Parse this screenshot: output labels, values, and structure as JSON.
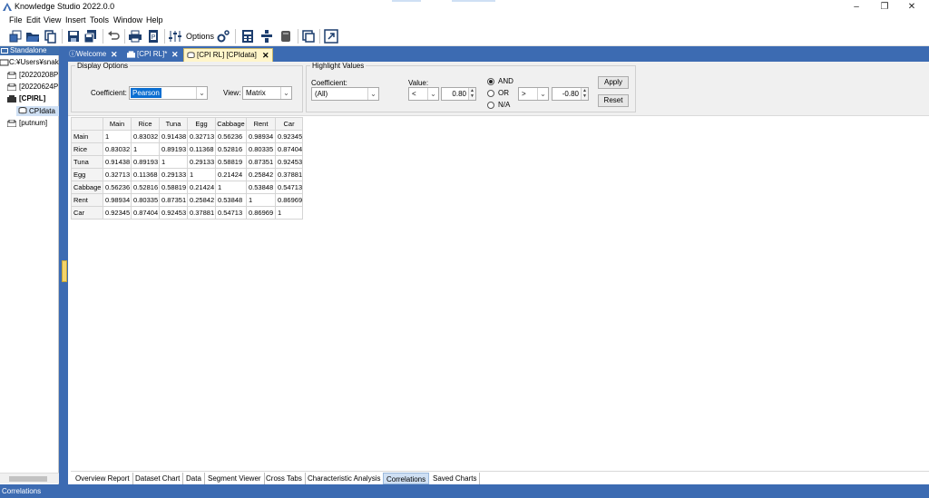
{
  "window": {
    "title": "Knowledge Studio 2022.0.0",
    "minimize": "–",
    "restore": "❐",
    "close": "✕"
  },
  "menu": [
    "File",
    "Edit",
    "View",
    "Insert",
    "Tools",
    "Window",
    "Help"
  ],
  "toolbar": {
    "options_label": "Options",
    "icons": [
      "new-project-icon",
      "open-folder-icon",
      "copy-icon",
      "save-icon",
      "save-all-icon",
      "undo-icon",
      "print-icon",
      "export-icon",
      "options-sliders-icon",
      "options-gear-icon",
      "calculator-icon",
      "tree-icon",
      "database-icon",
      "window-icon",
      "fullscreen-icon"
    ]
  },
  "left_panel": {
    "header": "Standalone",
    "items": [
      {
        "label": "C:¥Users¥snakai",
        "bold": false
      },
      {
        "label": "[20220208P",
        "bold": false
      },
      {
        "label": "[20220624P",
        "bold": false
      },
      {
        "label": "[CPIRL]",
        "bold": true
      },
      {
        "label": "CPIdata",
        "bold": false
      },
      {
        "label": "[putnum]",
        "bold": false
      }
    ]
  },
  "doc_tabs": [
    {
      "label": "Welcome",
      "active": false
    },
    {
      "label": "[CPI RL]*",
      "active": false
    },
    {
      "label": "[CPI RL] [CPIdata]",
      "active": true
    }
  ],
  "display_options": {
    "legend": "Display Options",
    "coefficient_label": "Coefficient:",
    "coefficient_value": "Pearson",
    "view_label": "View:",
    "view_value": "Matrix"
  },
  "highlight_values": {
    "legend": "Highlight Values",
    "coefficient_label": "Coefficient:",
    "coefficient_value": "(All)",
    "value_label": "Value:",
    "op1": "<",
    "val1": "0.80",
    "op2": ">",
    "val2": "-0.80",
    "radio_and": "AND",
    "radio_or": "OR",
    "radio_na": "N/A",
    "selected": "AND",
    "apply": "Apply",
    "reset": "Reset"
  },
  "correlations": {
    "columns": [
      "Main",
      "Rice",
      "Tuna",
      "Egg",
      "Cabbage",
      "Rent",
      "Car"
    ],
    "rows": [
      {
        "name": "Main",
        "values": [
          "1",
          "0.83032",
          "0.91438",
          "0.32713",
          "0.56236",
          "0.98934",
          "0.92345"
        ]
      },
      {
        "name": "Rice",
        "values": [
          "0.83032",
          "1",
          "0.89193",
          "0.11368",
          "0.52816",
          "0.80335",
          "0.87404"
        ]
      },
      {
        "name": "Tuna",
        "values": [
          "0.91438",
          "0.89193",
          "1",
          "0.29133",
          "0.58819",
          "0.87351",
          "0.92453"
        ]
      },
      {
        "name": "Egg",
        "values": [
          "0.32713",
          "0.11368",
          "0.29133",
          "1",
          "0.21424",
          "0.25842",
          "0.37881"
        ]
      },
      {
        "name": "Cabbage",
        "values": [
          "0.56236",
          "0.52816",
          "0.58819",
          "0.21424",
          "1",
          "0.53848",
          "0.54713"
        ]
      },
      {
        "name": "Rent",
        "values": [
          "0.98934",
          "0.80335",
          "0.87351",
          "0.25842",
          "0.53848",
          "1",
          "0.86969"
        ]
      },
      {
        "name": "Car",
        "values": [
          "0.92345",
          "0.87404",
          "0.92453",
          "0.37881",
          "0.54713",
          "0.86969",
          "1"
        ]
      }
    ]
  },
  "bottom_tabs": [
    {
      "label": "Overview Report",
      "active": false
    },
    {
      "label": "Dataset Chart",
      "active": false
    },
    {
      "label": "Data",
      "active": false
    },
    {
      "label": "Segment Viewer",
      "active": false
    },
    {
      "label": "Cross Tabs",
      "active": false
    },
    {
      "label": "Characteristic Analysis",
      "active": false
    },
    {
      "label": "Correlations",
      "active": true
    },
    {
      "label": "Saved Charts",
      "active": false
    }
  ],
  "status": "Correlations",
  "colors": {
    "brand_blue": "#3c6bb2",
    "active_tab": "#fff5c9",
    "selection": "#0a6ed1"
  }
}
